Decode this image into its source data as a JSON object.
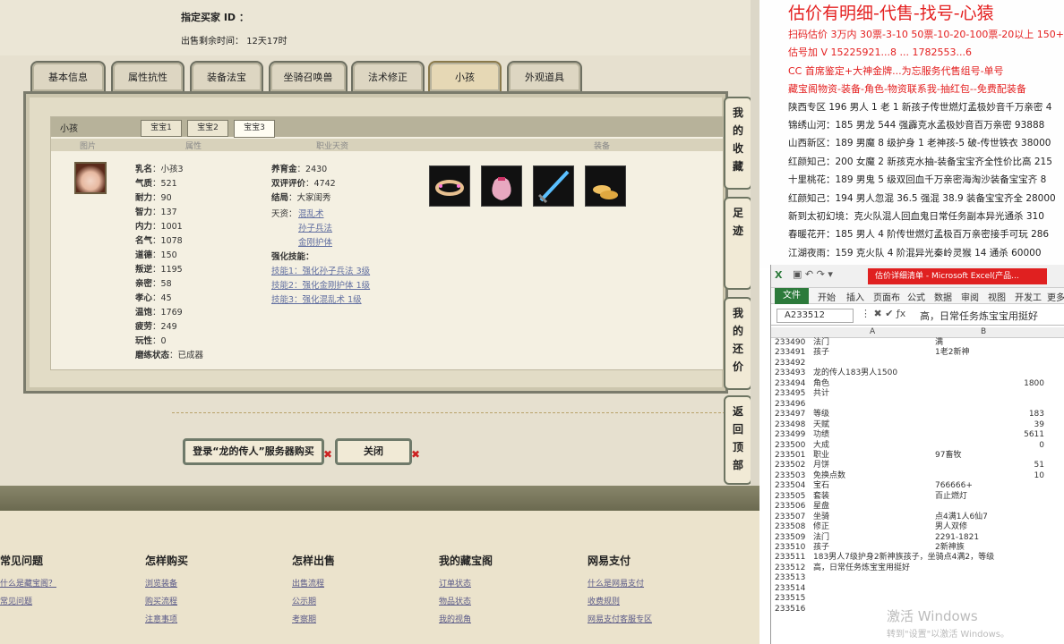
{
  "game": {
    "buyer_id_label": "指定买家 ID ：",
    "remaining_label": "出售剩余时间：",
    "remaining_value": "12天17时",
    "tabs": [
      "基本信息",
      "属性抗性",
      "装备法宝",
      "坐骑召唤兽",
      "法术修正",
      "小孩",
      "外观道具"
    ],
    "panel_title": "小孩",
    "subtabs": [
      "宝宝1",
      "宝宝2",
      "宝宝3"
    ],
    "col_headers": [
      "图片",
      "属性",
      "职业天资",
      "装备"
    ],
    "attrs_left": [
      {
        "label": "乳名",
        "value": "小孩3"
      },
      {
        "label": "气质",
        "value": "521"
      },
      {
        "label": "耐力",
        "value": "90"
      },
      {
        "label": "智力",
        "value": "137"
      },
      {
        "label": "内力",
        "value": "1001"
      },
      {
        "label": "名气",
        "value": "1078"
      },
      {
        "label": "道德",
        "value": "150"
      },
      {
        "label": "叛逆",
        "value": "1195"
      },
      {
        "label": "亲密",
        "value": "58"
      },
      {
        "label": "孝心",
        "value": "45"
      },
      {
        "label": "温饱",
        "value": "1769"
      },
      {
        "label": "疲劳",
        "value": "249"
      },
      {
        "label": "玩性",
        "value": "0"
      },
      {
        "label": "磨练状态",
        "value": "已成器"
      }
    ],
    "attrs_right": [
      {
        "label": "养育金",
        "value": "2430"
      },
      {
        "label": "双评评价",
        "value": "4742"
      },
      {
        "label": "结局",
        "value": "大家闺秀"
      }
    ],
    "talent_label": "天资：",
    "talents": [
      "混乱术",
      "孙子兵法",
      "金刚护体"
    ],
    "strengthen_label": "强化技能：",
    "skills": [
      "技能1：强化孙子兵法 3级",
      "技能2：强化金刚护体 1级",
      "技能3：强化混乱术 1级"
    ],
    "login_button": "登录“龙的传人”服务器购买",
    "close_button": "关闭",
    "side_nav": [
      "我的收藏",
      "足迹",
      "我的还价",
      "返回顶部"
    ],
    "footer": [
      {
        "title": "常见问题",
        "links": [
          "什么是藏宝阁？",
          "常见问题"
        ]
      },
      {
        "title": "怎样购买",
        "links": [
          "浏览装备",
          "购买流程",
          "注意事项"
        ]
      },
      {
        "title": "怎样出售",
        "links": [
          "出售流程",
          "公示期",
          "考察期"
        ]
      },
      {
        "title": "我的藏宝阁",
        "links": [
          "订单状态",
          "物品状态",
          "我的视角"
        ]
      },
      {
        "title": "网易支付",
        "links": [
          "什么是网易支付",
          "收费规则",
          "网易支付客服专区"
        ]
      }
    ]
  },
  "promo": {
    "headline": "估价有明细-代售-找号-心猿",
    "lines": [
      {
        "text": "扫码估价 3万内 30票-3-10 50票-10-20-100票-20以上 150+",
        "color": "#e42020"
      },
      {
        "text": "估号加 V 15225921...8 ... 1782553...6",
        "color": "#e42020"
      },
      {
        "text": "CC 首席鉴定+大神金牌...为忘服务代售组号-单号",
        "color": "#e42020"
      },
      {
        "text": "藏宝阁物资-装备-角色-物资联系我-抽红包--免费配装备",
        "color": "#e42020"
      },
      {
        "text": "陕西专区 196 男人 1 老 1 新孩子传世燃灯孟极妙音千万亲密 4",
        "color": "#222"
      },
      {
        "text": "锦绣山河：185 男龙 544 强霹克水孟极妙音百万亲密 93888",
        "color": "#222"
      },
      {
        "text": "山西新区：189 男魔 8 级护身 1 老神孩-5 破-传世铁衣 38000",
        "color": "#222"
      },
      {
        "text": "红颜知己：200 女魔 2 新孩克水抽-装备宝宝齐全性价比高 215",
        "color": "#222"
      },
      {
        "text": "十里桃花：189 男鬼 5 级双回血千万亲密海淘沙装备宝宝齐 8",
        "color": "#222"
      },
      {
        "text": "红颜知己：194 男人忽混 36.5 强混 38.9 装备宝宝齐全 28000",
        "color": "#222"
      },
      {
        "text": "新到太初幻境：克火队混人回血鬼日常任务副本异光通杀 310",
        "color": "#222"
      },
      {
        "text": "春暖花开：185 男人 4 阶传世燃灯孟极百万亲密接手可玩 286",
        "color": "#222"
      },
      {
        "text": "江湖夜雨：159 克火队 4 阶混异光秦岭灵猴 14 通杀 60000",
        "color": "#222"
      }
    ]
  },
  "excel": {
    "title": "估价详细清单 - Microsoft Excel(产品...",
    "menu": [
      "文件",
      "开始",
      "插入",
      "页面布",
      "公式",
      "数据",
      "审阅",
      "视图",
      "开发工",
      "更多"
    ],
    "name_box": "A233512",
    "formula": "高，日常任务炼宝宝用挺好",
    "col_a": "A",
    "col_b": "B",
    "rows": [
      {
        "n": "233490",
        "a": "法门",
        "b": "满",
        "num": false
      },
      {
        "n": "233491",
        "a": "孩子",
        "b": "1老2新神",
        "num": false
      },
      {
        "n": "233492",
        "a": "",
        "b": "",
        "num": false
      },
      {
        "n": "233493",
        "a": "龙的传人183男人1500",
        "b": "",
        "num": false
      },
      {
        "n": "233494",
        "a": "角色",
        "b": "1800",
        "num": true
      },
      {
        "n": "233495",
        "a": "共计",
        "b": "",
        "num": false
      },
      {
        "n": "233496",
        "a": "",
        "b": "",
        "num": false
      },
      {
        "n": "233497",
        "a": "等级",
        "b": "183",
        "num": true
      },
      {
        "n": "233498",
        "a": "天赋",
        "b": "39",
        "num": true
      },
      {
        "n": "233499",
        "a": "功绩",
        "b": "5611",
        "num": true
      },
      {
        "n": "233500",
        "a": "大成",
        "b": "0",
        "num": true
      },
      {
        "n": "233501",
        "a": "职业",
        "b": "97畜牧",
        "num": false
      },
      {
        "n": "233502",
        "a": "月饼",
        "b": "51",
        "num": true
      },
      {
        "n": "233503",
        "a": "免换点数",
        "b": "10",
        "num": true
      },
      {
        "n": "233504",
        "a": "宝石",
        "b": "766666+",
        "num": false
      },
      {
        "n": "233505",
        "a": "套装",
        "b": "百止燃灯",
        "num": false
      },
      {
        "n": "233506",
        "a": "星盘",
        "b": "",
        "num": false
      },
      {
        "n": "233507",
        "a": "坐骑",
        "b": "点4满1人6仙7",
        "num": false
      },
      {
        "n": "233508",
        "a": "修正",
        "b": "男人双修",
        "num": false
      },
      {
        "n": "233509",
        "a": "法门",
        "b": "2291-1821",
        "num": false
      },
      {
        "n": "233510",
        "a": "孩子",
        "b": "2新神族",
        "num": false
      },
      {
        "n": "233511",
        "a": "183男人7级护身2新神族孩子，坐骑点4满2，等级",
        "b": "",
        "num": false
      },
      {
        "n": "233512",
        "a": "高，日常任务炼宝宝用挺好",
        "b": "",
        "num": false
      },
      {
        "n": "233513",
        "a": "",
        "b": "",
        "num": false
      },
      {
        "n": "233514",
        "a": "",
        "b": "",
        "num": false
      },
      {
        "n": "233515",
        "a": "",
        "b": "",
        "num": false
      },
      {
        "n": "233516",
        "a": "",
        "b": "",
        "num": false
      }
    ]
  },
  "watermark": {
    "line1": "激活 Windows",
    "line2": "转到\"设置\"以激活 Windows。"
  }
}
